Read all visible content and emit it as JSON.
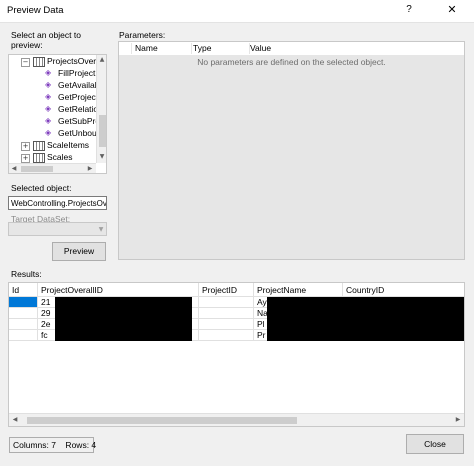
{
  "window": {
    "title": "Preview Data",
    "help_glyph": "?",
    "close_glyph": "✕"
  },
  "left": {
    "select_label": "Select an object to preview:",
    "tree": [
      {
        "label": "ProjectsOvera",
        "icon": "table-icon",
        "expander": "−"
      },
      {
        "label": "FillProject",
        "icon": "method-icon"
      },
      {
        "label": "GetAvailal",
        "icon": "method-icon"
      },
      {
        "label": "GetProject",
        "icon": "method-icon"
      },
      {
        "label": "GetRelatio",
        "icon": "method-icon"
      },
      {
        "label": "GetSubPro",
        "icon": "method-icon"
      },
      {
        "label": "GetUnbou",
        "icon": "method-icon"
      },
      {
        "label": "ScaleItems",
        "icon": "table-icon",
        "expander": "+"
      },
      {
        "label": "Scales",
        "icon": "table-icon",
        "expander": "+"
      }
    ],
    "selected_label": "Selected object:",
    "selected_value": "WebControlling.ProjectsOv",
    "target_label": "Target DataSet:",
    "target_value": "",
    "preview_button": "Preview"
  },
  "parameters": {
    "label": "Parameters:",
    "columns": [
      "Name",
      "Type",
      "Value"
    ],
    "empty_message": "No parameters are defined on the selected object."
  },
  "results": {
    "label": "Results:",
    "columns": [
      "Id",
      "ProjectOverallID",
      "ProjectID",
      "ProjectName",
      "CountryID"
    ],
    "rows": [
      [
        "",
        "21",
        "",
        "Ay",
        ""
      ],
      [
        "",
        "29",
        "",
        "Na",
        ""
      ],
      [
        "",
        "2e",
        "",
        "Pl",
        ""
      ],
      [
        "",
        "fc",
        "",
        "Pr",
        ""
      ]
    ]
  },
  "status": {
    "text": "Columns: 7    Rows: 4"
  },
  "footer": {
    "close_button": "Close"
  }
}
